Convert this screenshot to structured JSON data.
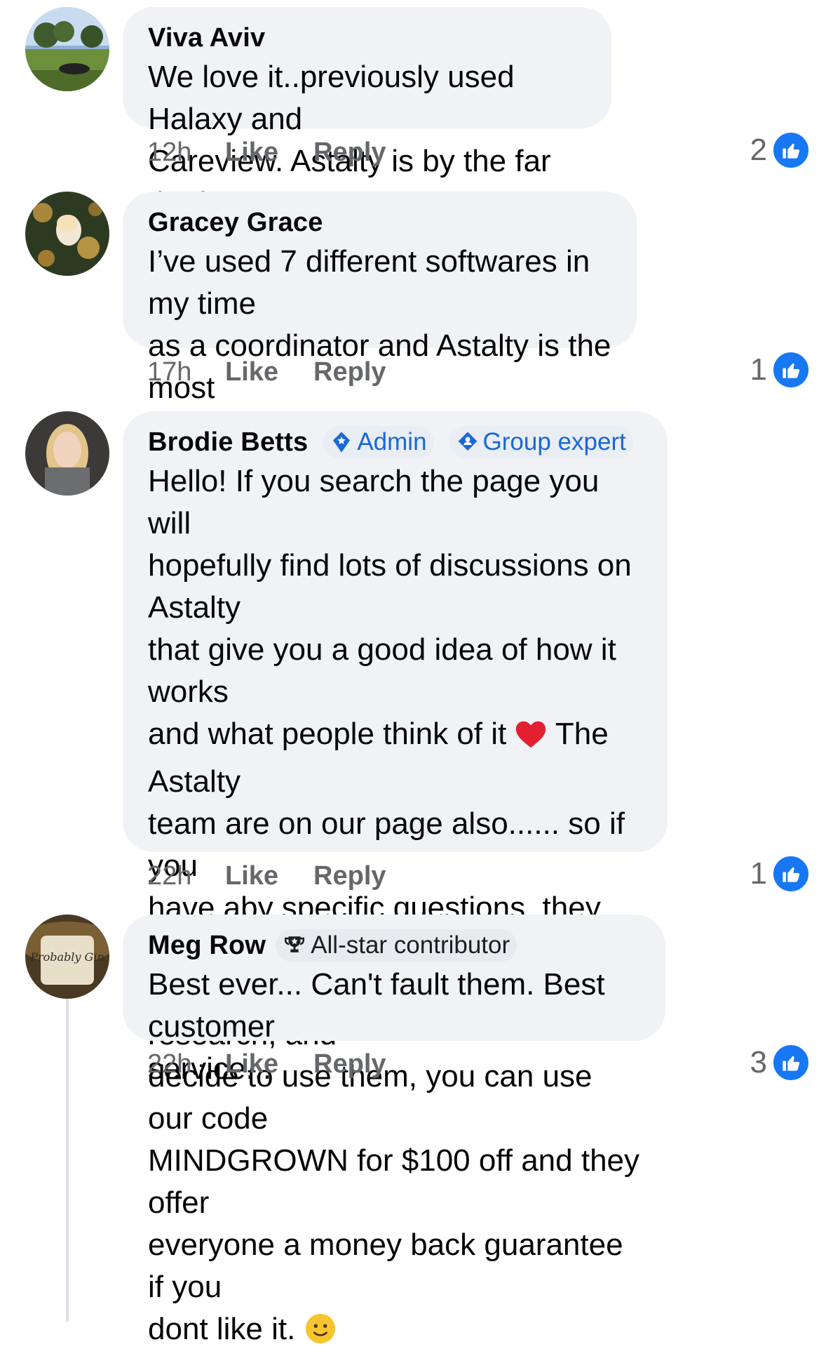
{
  "comments": [
    {
      "name": "Viva Aviv",
      "text": "We love it..previously used Halaxy and\nCareview. Astalty is by the far the best.",
      "time": "12h",
      "like_label": "Like",
      "reply_label": "Reply",
      "reaction_count": "2",
      "reaction_icon": "like-icon",
      "avatar_icon": "profile-photo-outdoor-park"
    },
    {
      "name": "Gracey Grace",
      "text": "I’ve used 7 different softwares in my time\nas a coordinator and Astalty is the most\nintuitive, easy to use",
      "time": "17h",
      "like_label": "Like",
      "reply_label": "Reply",
      "reaction_count": "1",
      "reaction_icon": "like-icon",
      "avatar_icon": "profile-photo-person-on-floral-blanket"
    },
    {
      "name": "Brodie Betts",
      "badges": [
        {
          "label": "Admin",
          "icon": "admin-shield-icon"
        },
        {
          "label": "Group expert",
          "icon": "group-expert-icon"
        }
      ],
      "text_parts": [
        "Hello! If you search the page you will\nhopefully find lots of discussions on Astalty\nthat give you a good idea of how it works\nand what people think of it ",
        " The Astalty\nteam are on our page also...... so if you\nhave aby specific questions, they are happy\nto help. If after you do your research, and\ndecide to use them, you can use our code\nMINDGROWN for $100 off and they offer\neveryone a money back guarantee if you\ndont like it. "
      ],
      "emoji": [
        "red-heart-emoji",
        "smiling-face-emoji"
      ],
      "time": "22h",
      "like_label": "Like",
      "reply_label": "Reply",
      "reaction_count": "1",
      "reaction_icon": "like-icon",
      "avatar_icon": "profile-photo-woman-blonde"
    },
    {
      "name": "Meg Row",
      "badges": [
        {
          "label": "All-star contributor",
          "icon": "trophy-icon"
        }
      ],
      "text": "Best ever... Can't fault them. Best customer\nservice...",
      "time": "22h",
      "like_label": "Like",
      "reply_label": "Reply",
      "reaction_count": "3",
      "reaction_icon": "like-icon",
      "avatar_icon": "profile-photo-mug",
      "avatar_text": "Probably Gin"
    }
  ],
  "colors": {
    "bubble": "#f0f2f5",
    "meta_text": "#65676b",
    "badge_blue": "#1a68d6",
    "like_blue": "#1877f2"
  }
}
